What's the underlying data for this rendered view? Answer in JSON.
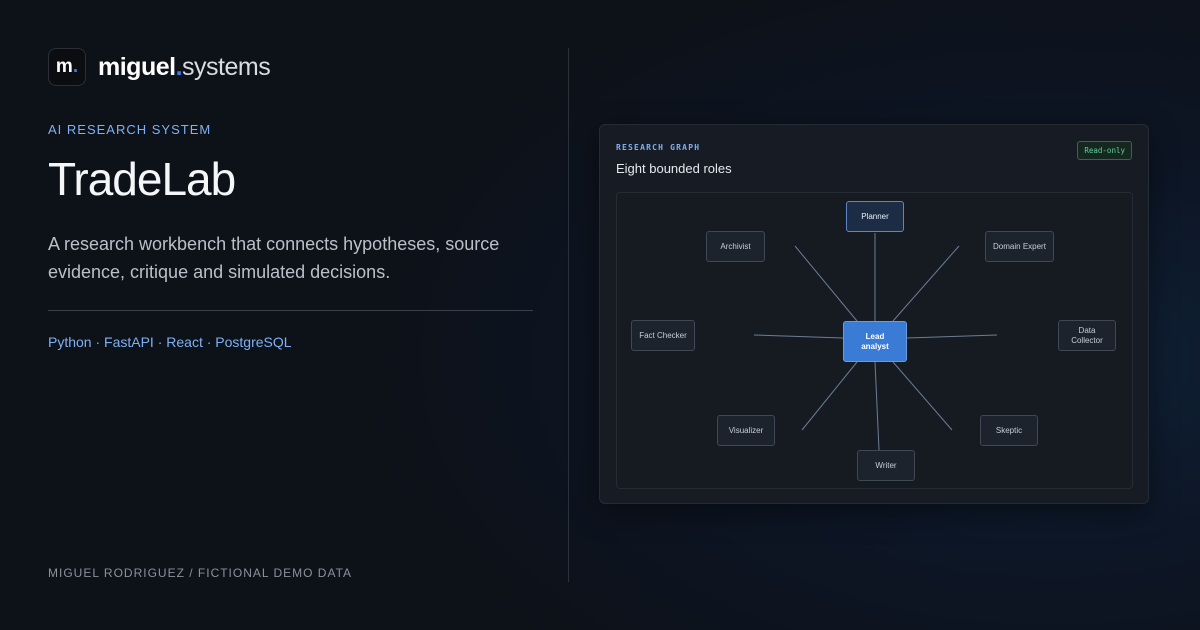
{
  "brand": {
    "logo": "m",
    "logo_dot": ".",
    "name": "miguel",
    "name_dot": ".",
    "name_suffix": "systems"
  },
  "eyebrow": "AI RESEARCH SYSTEM",
  "title": "TradeLab",
  "description": "A research workbench that connects hypotheses, source evidence, critique and simulated decisions.",
  "tech_stack": "Python · FastAPI · React · PostgreSQL",
  "footer": "MIGUEL RODRIGUEZ / FICTIONAL DEMO DATA",
  "card": {
    "label": "RESEARCH GRAPH",
    "title": "Eight bounded roles",
    "badge": "Read-only",
    "nodes": {
      "lead": "Lead analyst",
      "planner": "Planner",
      "archivist": "Archivist",
      "domain_expert": "Domain Expert",
      "fact_checker": "Fact Checker",
      "data_collector": "Data Collector",
      "visualizer": "Visualizer",
      "skeptic": "Skeptic",
      "writer": "Writer"
    }
  },
  "colors": {
    "accent": "#3b7bea",
    "link": "#7fb0f5",
    "badge": "#5fcf9a",
    "lead_node": "#3a7bd5"
  }
}
